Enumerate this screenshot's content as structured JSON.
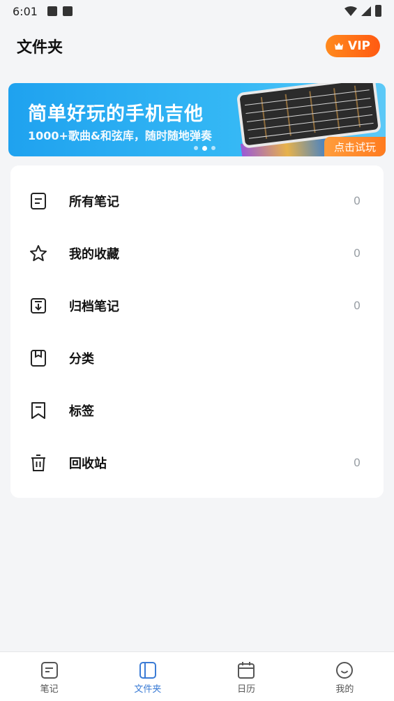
{
  "status_bar": {
    "time": "6:01"
  },
  "header": {
    "title": "文件夹",
    "vip_label": "VIP"
  },
  "banner": {
    "title": "简单好玩的手机吉他",
    "subtitle": "1000+歌曲&和弦库，随时随地弹奏",
    "try_label": "点击试玩",
    "pages": 3,
    "active_page": 2
  },
  "folders": [
    {
      "name": "all-notes",
      "icon": "note-icon",
      "label": "所有笔记",
      "count": "0"
    },
    {
      "name": "favorites",
      "icon": "star-icon",
      "label": "我的收藏",
      "count": "0"
    },
    {
      "name": "archived",
      "icon": "archive-icon",
      "label": "归档笔记",
      "count": "0"
    },
    {
      "name": "category",
      "icon": "category-icon",
      "label": "分类",
      "count": ""
    },
    {
      "name": "tags",
      "icon": "tag-icon",
      "label": "标签",
      "count": ""
    },
    {
      "name": "trash",
      "icon": "trash-icon",
      "label": "回收站",
      "count": "0"
    }
  ],
  "tabbar": {
    "items": [
      {
        "label": "笔记",
        "icon": "notes-tab-icon",
        "active": false
      },
      {
        "label": "文件夹",
        "icon": "folder-tab-icon",
        "active": true
      },
      {
        "label": "日历",
        "icon": "calendar-tab-icon",
        "active": false
      },
      {
        "label": "我的",
        "icon": "profile-tab-icon",
        "active": false
      }
    ]
  },
  "colors": {
    "accent": "#3a7bd5",
    "vip_orange": "#ff6a14",
    "banner_blue": "#1fa2ef"
  }
}
